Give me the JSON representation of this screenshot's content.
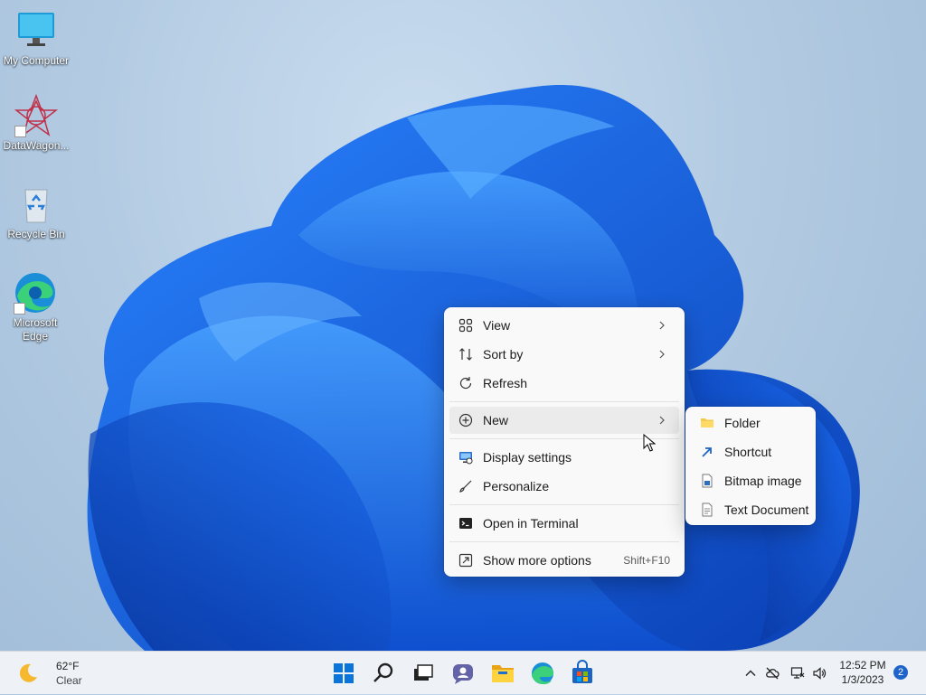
{
  "desktop": {
    "icons": [
      {
        "label": "My Computer",
        "icon": "monitor-icon"
      },
      {
        "label": "DataWagon...",
        "icon": "datawagon-icon"
      },
      {
        "label": "Recycle Bin",
        "icon": "recycle-bin-icon"
      },
      {
        "label": "Microsoft Edge",
        "icon": "edge-icon"
      }
    ]
  },
  "context_menu": {
    "items": [
      {
        "label": "View",
        "icon": "grid-icon",
        "has_submenu": true
      },
      {
        "label": "Sort by",
        "icon": "sort-icon",
        "has_submenu": true
      },
      {
        "label": "Refresh",
        "icon": "refresh-icon",
        "has_submenu": false
      },
      {
        "label": "New",
        "icon": "plus-circle-icon",
        "has_submenu": true
      },
      {
        "label": "Display settings",
        "icon": "display-icon",
        "has_submenu": false
      },
      {
        "label": "Personalize",
        "icon": "brush-icon",
        "has_submenu": false
      },
      {
        "label": "Open in Terminal",
        "icon": "terminal-icon",
        "has_submenu": false
      },
      {
        "label": "Show more options",
        "icon": "more-options-icon",
        "shortcut": "Shift+F10"
      }
    ]
  },
  "submenu_new": {
    "items": [
      {
        "label": "Folder",
        "icon": "folder-icon"
      },
      {
        "label": "Shortcut",
        "icon": "shortcut-arrow-icon"
      },
      {
        "label": "Bitmap image",
        "icon": "bitmap-icon"
      },
      {
        "label": "Text Document",
        "icon": "text-document-icon"
      }
    ]
  },
  "taskbar": {
    "weather": {
      "temperature": "62°F",
      "condition": "Clear",
      "icon": "moon-icon"
    },
    "apps": [
      "start-icon",
      "search-icon",
      "task-view-icon",
      "chat-icon",
      "file-explorer-icon",
      "edge-icon",
      "store-icon"
    ],
    "tray": [
      "chevron-up-icon",
      "cloud-offline-icon",
      "network-icon",
      "volume-icon"
    ],
    "time": "12:52 PM",
    "date": "1/3/2023",
    "notification_count": "2"
  },
  "colors": {
    "accent": "#0067c0",
    "wallpaper_bloom": "#1565e8",
    "menu_bg": "#f9f9f9",
    "taskbar_bg": "#eef1f6"
  }
}
